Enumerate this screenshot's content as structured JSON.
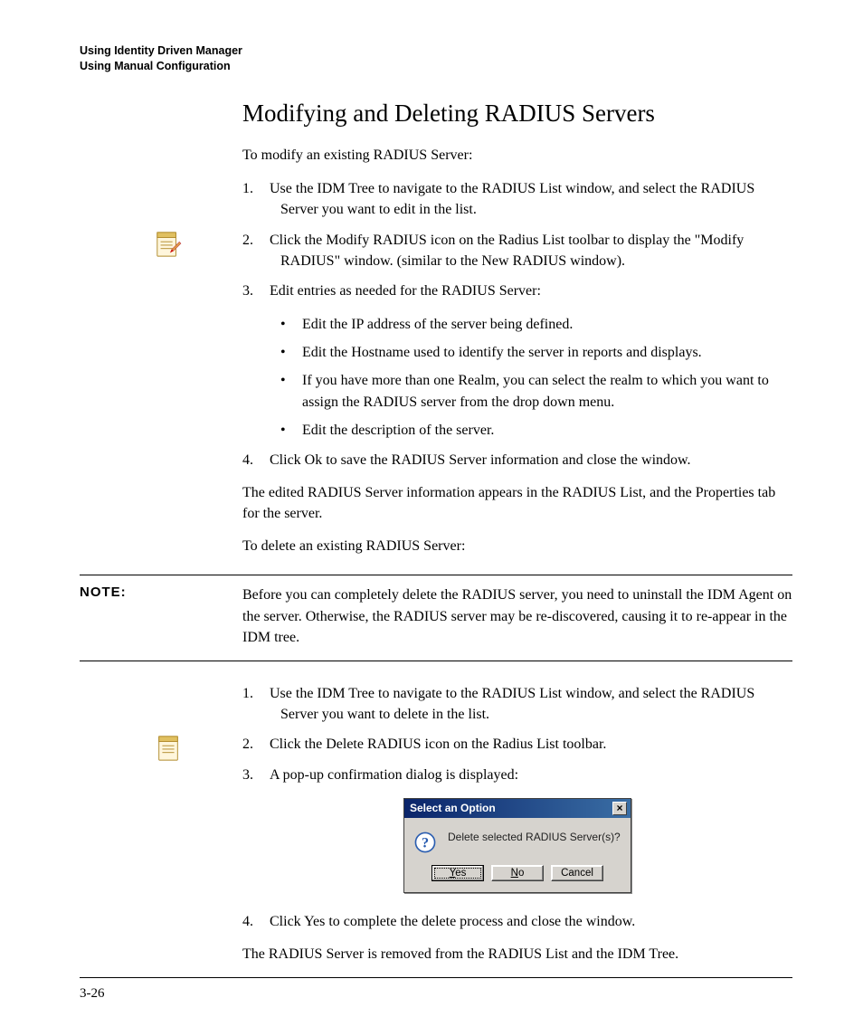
{
  "header": {
    "line1": "Using Identity Driven Manager",
    "line2": "Using Manual Configuration"
  },
  "section_title": "Modifying and Deleting RADIUS Servers",
  "intro_modify": "To modify an existing RADIUS Server:",
  "modify_steps": {
    "s1_num": "1.",
    "s1": "Use the IDM Tree to navigate to the RADIUS List window, and select the RADIUS Server you want to edit in the list.",
    "s2_num": "2.",
    "s2": "Click the Modify RADIUS icon on the Radius List toolbar to display the \"Modify RADIUS\" window. (similar to the New RADIUS window).",
    "s3_num": "3.",
    "s3": "Edit entries as needed for the RADIUS Server:",
    "s4_num": "4.",
    "s4": "Click Ok to save the RADIUS Server information and close the window."
  },
  "modify_bullets": {
    "b1": "Edit the IP address of the server being defined.",
    "b2": "Edit the Hostname used to identify the server in reports and displays.",
    "b3": "If you have more than one Realm, you can select the realm to which you want to assign the RADIUS server from the drop down menu.",
    "b4": "Edit the description of the server."
  },
  "after_modify": "The edited RADIUS Server information appears in the RADIUS List, and the Properties tab for the server.",
  "intro_delete": "To delete an existing RADIUS Server:",
  "note": {
    "label": "NOTE:",
    "text": "Before you can completely delete the RADIUS server, you need to uninstall the IDM Agent on the server. Otherwise, the RADIUS server may be re-discovered, causing it to re-appear in the IDM tree."
  },
  "delete_steps": {
    "s1_num": "1.",
    "s1": "Use the IDM Tree to navigate to the RADIUS List window, and select the RADIUS Server you want to delete in the list.",
    "s2_num": "2.",
    "s2": "Click the Delete RADIUS icon on the Radius List toolbar.",
    "s3_num": "3.",
    "s3": "A pop-up confirmation dialog is displayed:",
    "s4_num": "4.",
    "s4": "Click Yes to complete the delete process and close the window."
  },
  "dialog": {
    "title": "Select an Option",
    "message": "Delete selected RADIUS Server(s)?",
    "yes_label_u": "Y",
    "yes_label_rest": "es",
    "no_label_u": "N",
    "no_label_rest": "o",
    "cancel_label": "Cancel"
  },
  "after_delete": "The RADIUS Server is removed from the RADIUS List and the IDM Tree.",
  "page_number": "3-26",
  "bullet_glyph": "•"
}
